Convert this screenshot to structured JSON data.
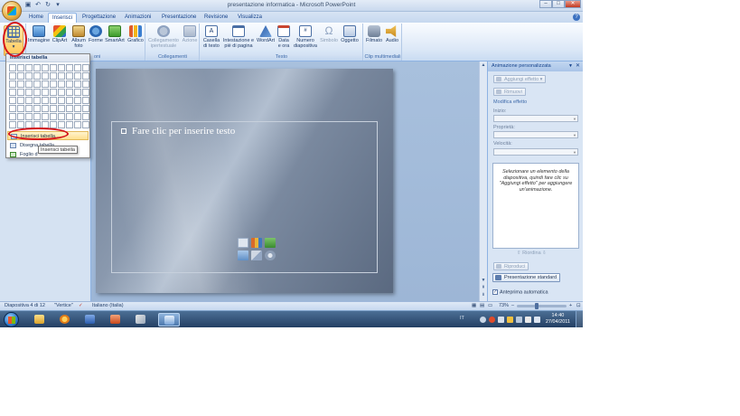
{
  "window": {
    "title": "presentazione informatica - Microsoft PowerPoint",
    "controls": [
      "–",
      "□",
      "✕"
    ]
  },
  "tabs": [
    {
      "label": "Home"
    },
    {
      "label": "Inserisci"
    },
    {
      "label": "Progettazione"
    },
    {
      "label": "Animazioni"
    },
    {
      "label": "Presentazione"
    },
    {
      "label": "Revisione"
    },
    {
      "label": "Visualizza"
    }
  ],
  "ribbon": {
    "buttons": {
      "tabella": "Tabella",
      "immagine": "Immagine",
      "clipart": "ClipArt",
      "album": "Album foto",
      "forme": "Forme",
      "smartart": "SmartArt",
      "grafico": "Grafico",
      "collegamento": "Collegamento ipertestuale",
      "azione": "Azione",
      "casella_testo": "Casella di testo",
      "intestazione": "Intestazione e piè di pagina",
      "wordart": "WordArt",
      "data_ora": "Data e ora",
      "numero_diapositiva": "Numero diapositiva",
      "simbolo": "Simbolo",
      "oggetto": "Oggetto",
      "filmato": "Filmato",
      "audio": "Audio"
    },
    "groups": {
      "illustrazioni_tail": "oni",
      "collegamenti": "Collegamenti",
      "testo": "Testo",
      "clip": "Clip multimediali"
    }
  },
  "dropdown": {
    "header": "Inserisci tabella",
    "items": {
      "inserisci": "Inserisci tabella...",
      "disegna": "Disegna tabella",
      "foglio": "Foglio d"
    },
    "tooltip": "Inserisci tabella"
  },
  "slide": {
    "placeholder": "Fare clic per inserire testo"
  },
  "task_pane": {
    "title": "Animazione personalizzata",
    "aggiungi_effetto": "Aggiungi effetto",
    "rimuovi": "Rimuovi",
    "modifica_effetto": "Modifica effetto",
    "inizio": "Inizio:",
    "proprieta": "Proprietà:",
    "velocita": "Velocità:",
    "info": "Selezionare un elemento della diapositiva, quindi fare clic su \"Aggiungi effetto\" per aggiungere un'animazione.",
    "riordina": "Riordina",
    "riproduci": "Riproduci",
    "presentazione_standard": "Presentazione standard",
    "anteprima": "Anteprima automatica"
  },
  "status": {
    "slide_info": "Diapositiva 4 di 12",
    "theme": "\"Vertice\"",
    "language": "Italiano (Italia)",
    "zoom": "73%"
  },
  "taskbar": {
    "time": "14:40",
    "date": "27/04/2011",
    "tray_label": "IT"
  },
  "colors": {
    "ribbon_text": "#15428b",
    "highlight_red": "#d4141b",
    "taskbar": "#233f63"
  }
}
